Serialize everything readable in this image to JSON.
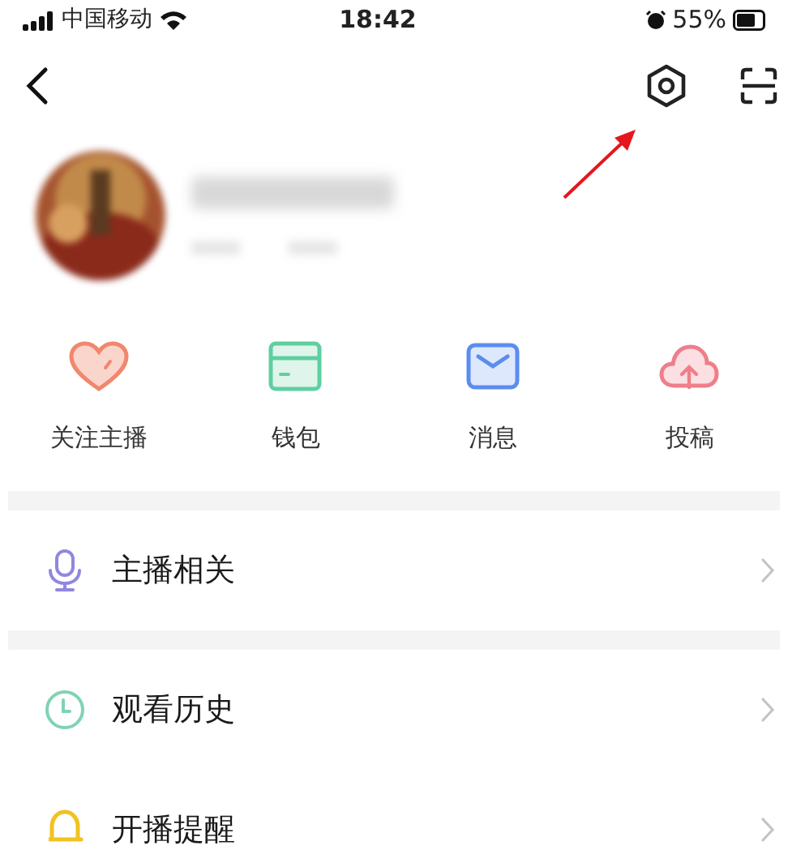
{
  "status_bar": {
    "carrier": "中国移动",
    "time": "18:42",
    "battery": "55%"
  },
  "quick_actions": [
    {
      "label": "关注主播",
      "kind": "heart",
      "color": "#f0876e"
    },
    {
      "label": "钱包",
      "kind": "wallet",
      "color": "#5fcfa0"
    },
    {
      "label": "消息",
      "kind": "mail",
      "color": "#5b8def"
    },
    {
      "label": "投稿",
      "kind": "upload",
      "color": "#ee7f8a"
    }
  ],
  "menu": [
    {
      "group": [
        {
          "label": "主播相关",
          "kind": "mic",
          "color": "#8f87e0"
        }
      ]
    },
    {
      "group": [
        {
          "label": "观看历史",
          "kind": "clock",
          "color": "#7fd3b3"
        },
        {
          "label": "开播提醒",
          "kind": "bell",
          "color": "#f2c21f"
        }
      ]
    }
  ]
}
